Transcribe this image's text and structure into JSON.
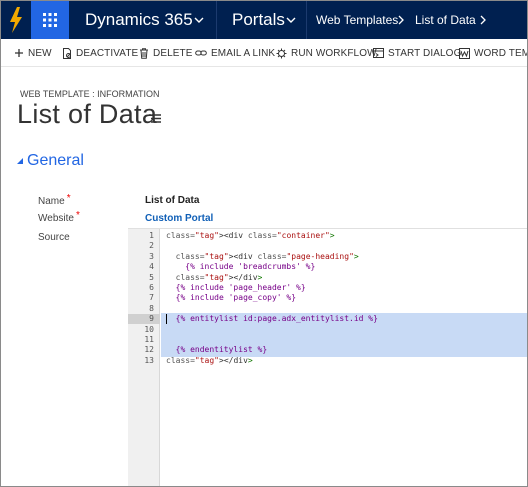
{
  "nav": {
    "app_name": "Dynamics 365",
    "area": "Portals",
    "breadcrumbs": [
      "Web Templates",
      "List of Data"
    ]
  },
  "commands": [
    {
      "label": "NEW",
      "icon": "plus-icon"
    },
    {
      "label": "DEACTIVATE",
      "icon": "deactivate-icon"
    },
    {
      "label": "DELETE",
      "icon": "trash-icon"
    },
    {
      "label": "EMAIL A LINK",
      "icon": "link-icon"
    },
    {
      "label": "RUN WORKFLOW",
      "icon": "workflow-icon"
    },
    {
      "label": "START DIALOG",
      "icon": "dialog-icon"
    },
    {
      "label": "WORD TEMPLATES",
      "icon": "word-icon"
    }
  ],
  "header": {
    "entity_label": "WEB TEMPLATE : INFORMATION",
    "title": "List of Data"
  },
  "section": {
    "title": "General"
  },
  "fields": {
    "name_label": "Name",
    "name_value": "List of Data",
    "website_label": "Website",
    "website_value": "Custom Portal",
    "source_label": "Source",
    "required_marker": "*"
  },
  "source_lines": [
    {
      "n": "1",
      "text": "<div class=\"container\">"
    },
    {
      "n": "2",
      "text": ""
    },
    {
      "n": "3",
      "text": "  <div class=\"page-heading\">"
    },
    {
      "n": "4",
      "text": "    {% include 'breadcrumbs' %}"
    },
    {
      "n": "5",
      "text": "  </div>"
    },
    {
      "n": "6",
      "text": "  {% include 'page_header' %}"
    },
    {
      "n": "7",
      "text": "  {% include 'page_copy' %}"
    },
    {
      "n": "8",
      "text": ""
    },
    {
      "n": "9",
      "text": "  {% entitylist id:page.adx_entitylist.id %}"
    },
    {
      "n": "10",
      "text": ""
    },
    {
      "n": "11",
      "text": ""
    },
    {
      "n": "12",
      "text": "  {% endentitylist %}"
    },
    {
      "n": "13",
      "text": "</div>"
    }
  ],
  "colors": {
    "nav_bg": "#002050",
    "waffle_bg": "#2266e3",
    "accent": "#2266e3",
    "brand_bolt": "#f2a900",
    "selection": "#c8daf5"
  }
}
